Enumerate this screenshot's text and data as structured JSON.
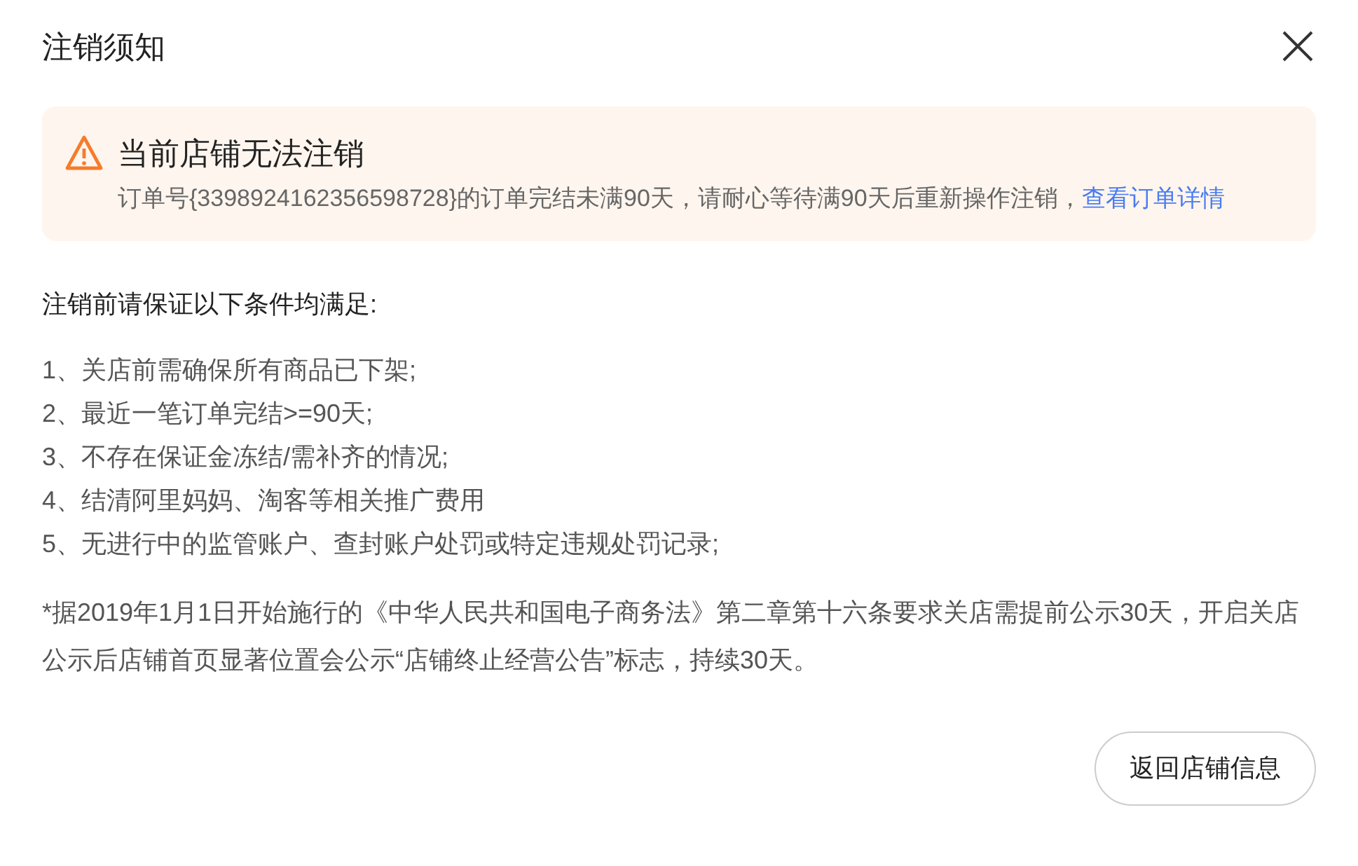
{
  "dialog": {
    "title": "注销须知",
    "alert": {
      "title": "当前店铺无法注销",
      "message": "订单号{3398924162356598728}的订单完结未满90天，请耐心等待满90天后重新操作注销，",
      "link": "查看订单详情"
    },
    "conditions_heading": "注销前请保证以下条件均满足:",
    "conditions": [
      "1、关店前需确保所有商品已下架;",
      "2、最近一笔订单完结>=90天;",
      "3、不存在保证金冻结/需补齐的情况;",
      "4、结清阿里妈妈、淘客等相关推广费用",
      "5、无进行中的监管账户、查封账户处罚或特定违规处罚记录;"
    ],
    "note": "*据2019年1月1日开始施行的《中华人民共和国电子商务法》第二章第十六条要求关店需提前公示30天，开启关店公示后店铺首页显著位置会公示“店铺终止经营公告”标志，持续30天。",
    "buttons": [
      "返回店铺信息"
    ]
  }
}
